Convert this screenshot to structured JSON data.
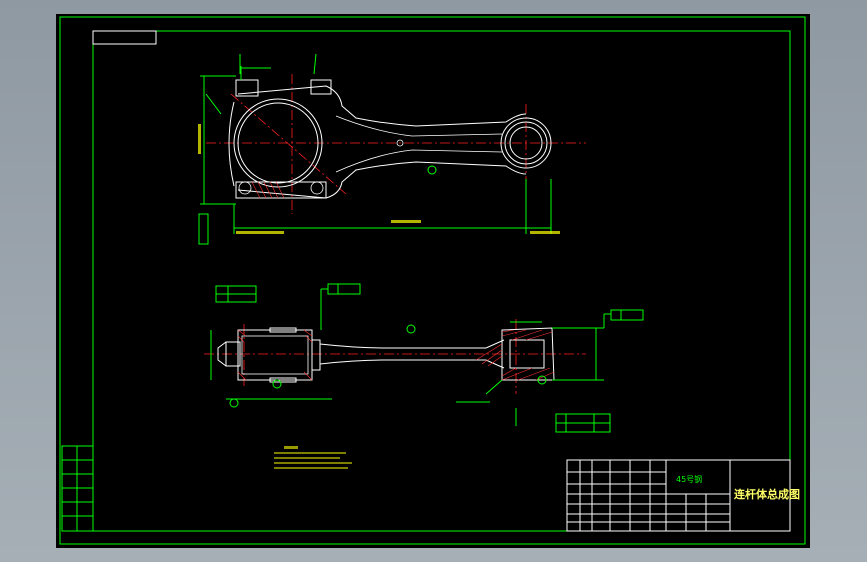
{
  "title_block": {
    "material": "45号钢",
    "drawing_title": "连杆体总成图"
  }
}
